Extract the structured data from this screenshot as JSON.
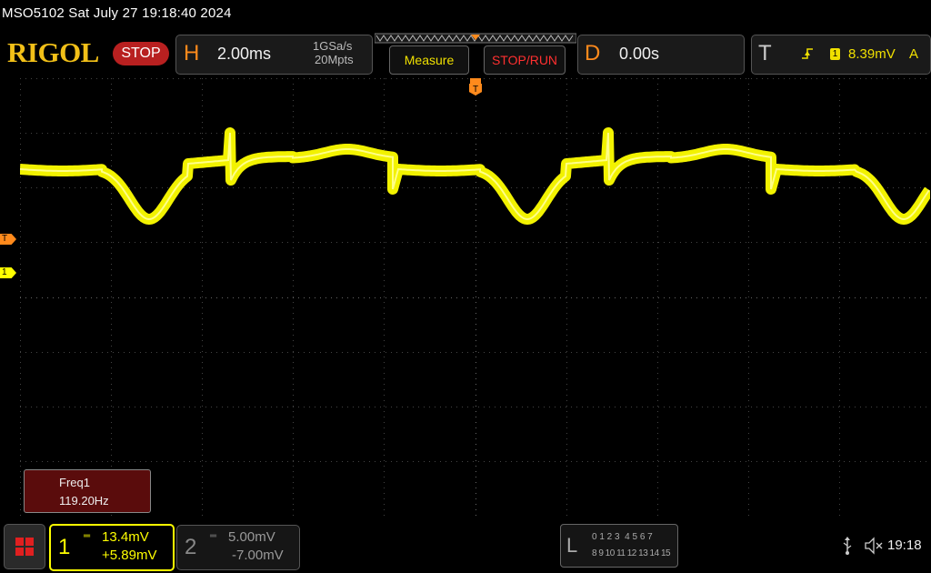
{
  "status": {
    "text": "MSO5102  Sat July 27 19:18:40 2024"
  },
  "brand": {
    "logo": "RIGOL",
    "run_state": "STOP"
  },
  "horizontal": {
    "letter": "H",
    "timebase": "2.00ms",
    "sample_rate": "1GSa/s",
    "memory_depth": "20Mpts"
  },
  "toolbar": {
    "measure_label": "Measure",
    "stoprun_label": "STOP/RUN"
  },
  "delay": {
    "letter": "D",
    "value": "0.00s"
  },
  "trigger": {
    "letter": "T",
    "source": "1",
    "level": "8.39mV",
    "mode": "A",
    "marker": "T"
  },
  "markers": {
    "trigger_level": "T",
    "channel1": "1"
  },
  "measurement": {
    "name": "Freq1",
    "value": "119.20Hz"
  },
  "channel1": {
    "number": "1",
    "scale": "13.4mV",
    "offset": "+5.89mV",
    "color": "#ffff00"
  },
  "channel2": {
    "number": "2",
    "scale": "5.00mV",
    "offset": "-7.00mV"
  },
  "logic": {
    "letter": "L",
    "row1": "0 1 2 3  4 5 6 7",
    "row2": "8 9 10 11 12 13 14 15"
  },
  "system": {
    "time": "19:18",
    "icons": [
      "usb-icon",
      "speaker-muted-icon"
    ]
  },
  "colors": {
    "accent": "#ff8a1c",
    "channel1": "#ffff00",
    "stop": "#b82020"
  }
}
